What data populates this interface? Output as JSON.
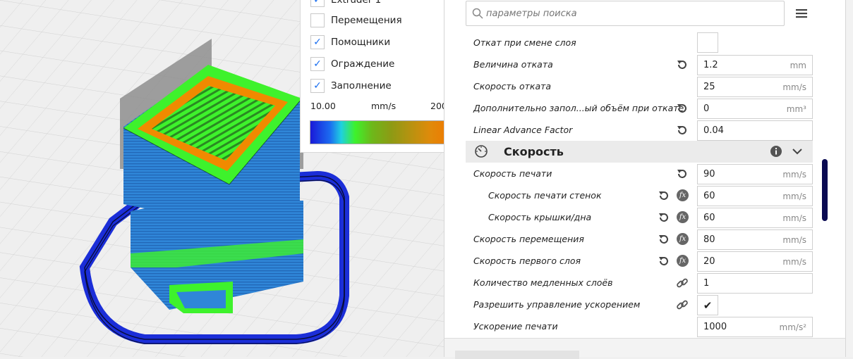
{
  "legend": {
    "partial_top_label": "Extruder 1",
    "items": [
      {
        "label": "Перемещения",
        "checked": false
      },
      {
        "label": "Помощники",
        "checked": true
      },
      {
        "label": "Ограждение",
        "checked": true
      },
      {
        "label": "Заполнение",
        "checked": true
      }
    ],
    "gradient_min": "10.00",
    "gradient_unit": "mm/s",
    "gradient_max": "200",
    "check_glyph": "✓"
  },
  "search": {
    "placeholder": "параметры поиска"
  },
  "icons": {
    "search": "search-icon",
    "menu": "hamburger-menu-icon",
    "reset": "reset-arrow-icon",
    "fx": "function-icon",
    "link": "link-icon",
    "gauge": "speedometer-icon",
    "info": "info-icon",
    "chevron": "chevron-down-icon"
  },
  "settings_rows_top": [
    {
      "label": "Откат при смене слоя",
      "type": "checkbox",
      "value": ""
    },
    {
      "label": "Величина отката",
      "value": "1.2",
      "unit": "mm",
      "reset": true
    },
    {
      "label": "Скорость отката",
      "value": "25",
      "unit": "mm/s"
    },
    {
      "label": "Дополнительно запол...ый объём при откате",
      "value": "0",
      "unit": "mm³",
      "reset": true
    },
    {
      "label": "Linear Advance Factor",
      "value": "0.04",
      "unit": "",
      "reset": true
    }
  ],
  "section": {
    "title": "Скорость"
  },
  "settings_rows_speed": [
    {
      "label": "Скорость печати",
      "value": "90",
      "unit": "mm/s",
      "reset": true
    },
    {
      "label": "Скорость печати стенок",
      "value": "60",
      "unit": "mm/s",
      "reset": true,
      "fx": true,
      "fx_text": "fx"
    },
    {
      "label": "Скорость крышки/дна",
      "value": "60",
      "unit": "mm/s",
      "reset": true,
      "fx": true,
      "fx_text": "fx"
    },
    {
      "label": "Скорость перемещения",
      "value": "80",
      "unit": "mm/s",
      "reset": true,
      "fx": true,
      "fx_text": "fx"
    },
    {
      "label": "Скорость первого слоя",
      "value": "20",
      "unit": "mm/s",
      "reset": true,
      "fx": true,
      "fx_text": "fx"
    },
    {
      "label": "Количество медленных слоёв",
      "value": "1",
      "unit": "",
      "link": true
    },
    {
      "label": "Разрешить управление ускорением",
      "type": "checkbox",
      "value": "✔",
      "link": true
    },
    {
      "label": "Ускорение печати",
      "value": "1000",
      "unit": "mm/s²"
    }
  ],
  "colors": {
    "accent_check": "#196ef0",
    "skirt": "#1a3ce0",
    "walls": "#2f86d8",
    "infill": "#f08a00",
    "helpers": "#3ef22c",
    "scrollbar": "#0a0a52"
  }
}
